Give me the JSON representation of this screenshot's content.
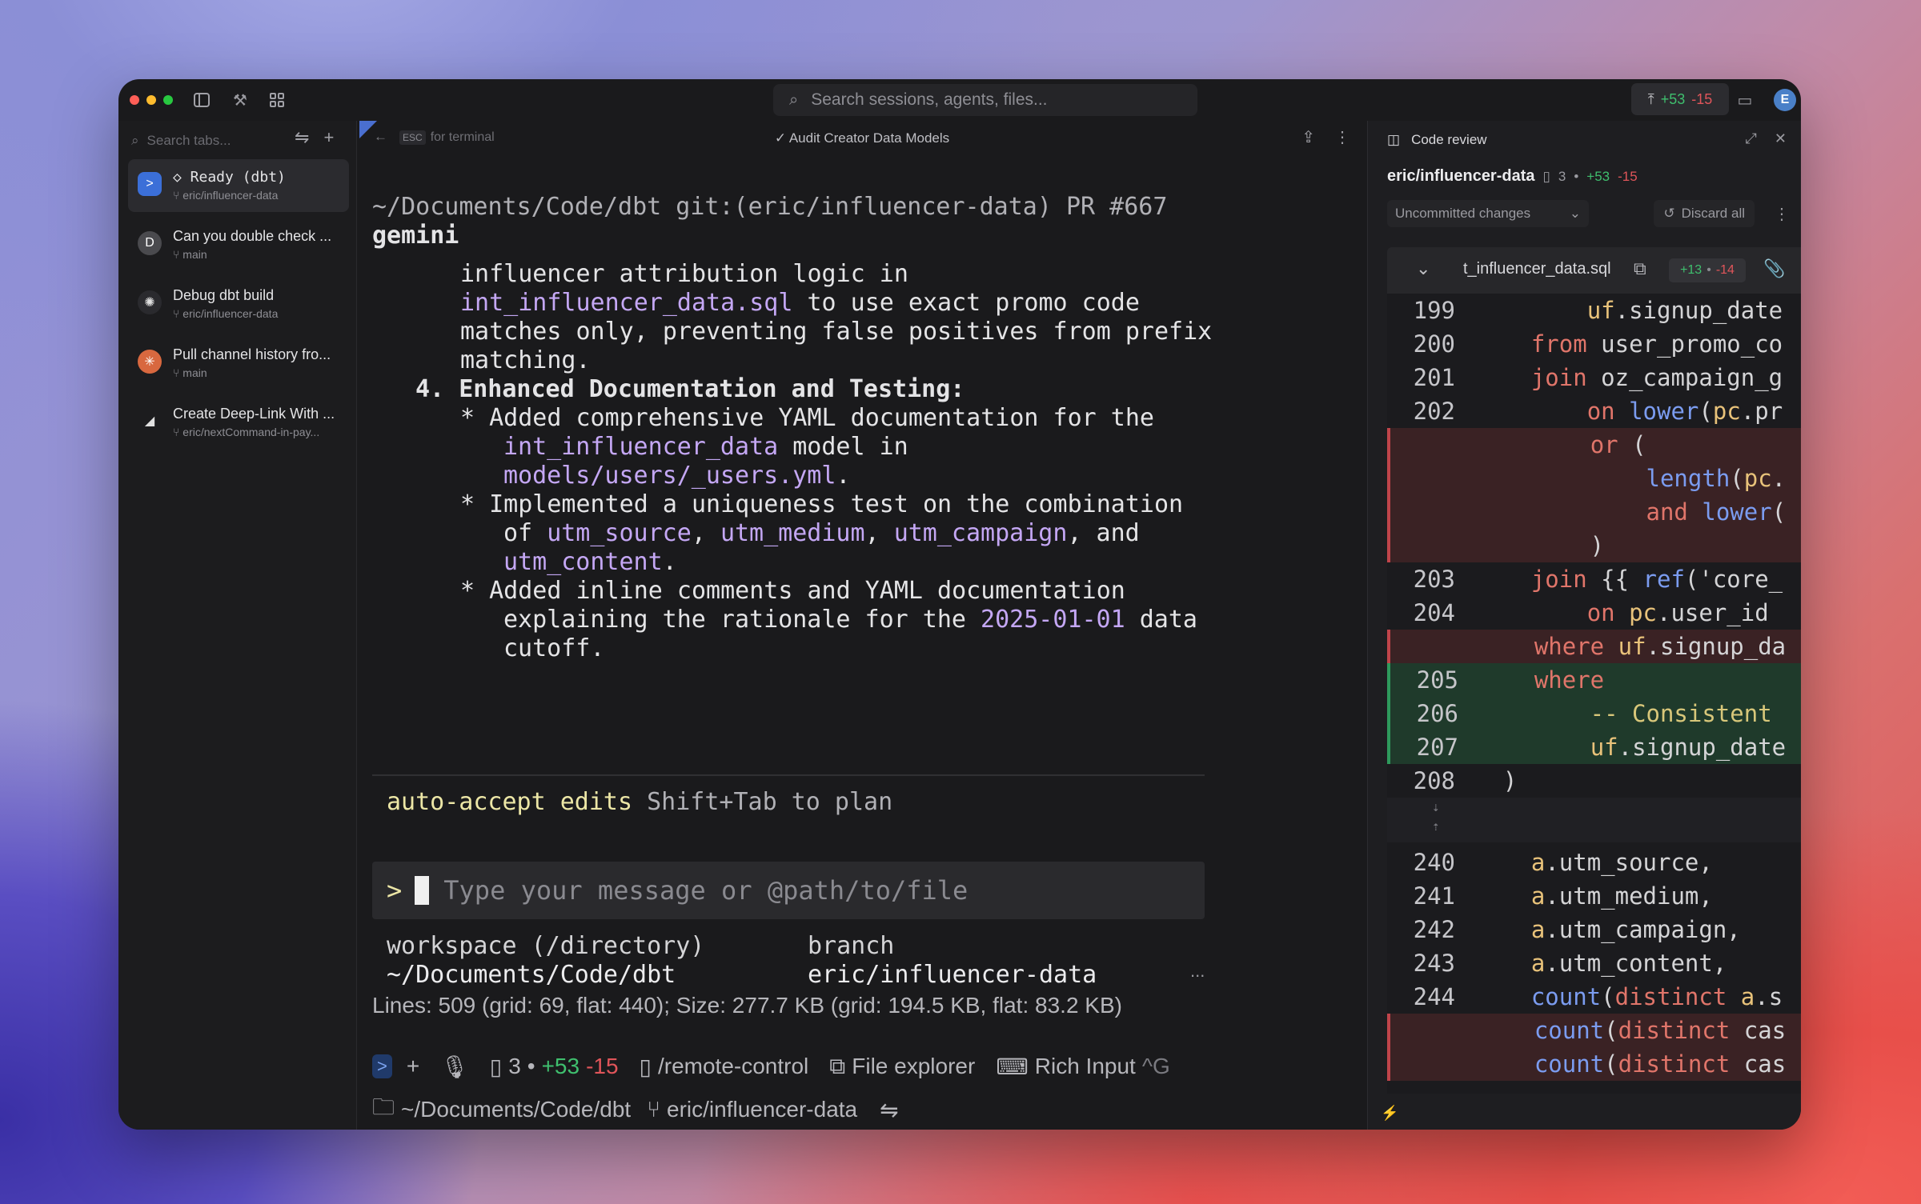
{
  "search": {
    "placeholder": "Search sessions, agents, files..."
  },
  "titlebar": {
    "diff_add": "+53",
    "diff_del": "-15",
    "avatar": "E"
  },
  "sidebar": {
    "search_placeholder": "Search tabs...",
    "tabs": [
      {
        "title": "◇  Ready (dbt)",
        "sub": "eric/influencer-data",
        "active": true
      },
      {
        "title": "Can you double check ...",
        "sub": "main"
      },
      {
        "title": "Debug dbt build",
        "sub": "eric/influencer-data"
      },
      {
        "title": "Pull channel history fro...",
        "sub": "main"
      },
      {
        "title": "Create Deep-Link With ...",
        "sub": "eric/nextCommand-in-pay..."
      }
    ]
  },
  "center": {
    "esc_key": "ESC",
    "esc_label": "for terminal",
    "title": "Audit Creator Data Models",
    "prompt_path": "~/Documents/Code/dbt git:(eric/influencer-data) PR #667",
    "agent": "gemini",
    "lines": {
      "l1": "influencer attribution logic in",
      "l2a": "int_influencer_data.sql",
      "l2b": " to use exact promo code",
      "l3": "matches only, preventing false positives from prefix",
      "l4": "matching.",
      "l5a": "4. ",
      "l5b": "Enhanced Documentation and Testing:",
      "l6": "* Added comprehensive YAML documentation for the",
      "l7a": "int_influencer_data",
      "l7b": " model in",
      "l8a": "models/users/_users.yml",
      "l8b": ".",
      "l9": "* Implemented a uniqueness test on the combination",
      "l10a": "of ",
      "l10b": "utm_source",
      "l10c": ", ",
      "l10d": "utm_medium",
      "l10e": ", ",
      "l10f": "utm_campaign",
      "l10g": ", and",
      "l11a": "utm_content",
      "l11b": ".",
      "l12": "* Added inline comments and YAML documentation",
      "l13a": "explaining the rationale for the ",
      "l13b": "2025-01-01",
      "l13c": " data",
      "l14": "cutoff."
    },
    "mode_label": "auto-accept edits",
    "mode_hint": "Shift+Tab to plan",
    "input_prompt": ">",
    "input_placeholder": "Type your message or @path/to/file",
    "ws_label": "workspace (/directory)",
    "ws_value": "~/Documents/Code/dbt",
    "branch_label": "branch",
    "branch_value": "eric/influencer-data",
    "ellipsis": "...",
    "stats": "Lines: 509 (grid: 69, flat: 440); Size: 277.7 KB (grid: 194.5 KB, flat: 83.2 KB)",
    "bar": {
      "files": "3",
      "dot": "•",
      "add": "+53",
      "del": "-15",
      "remote": "/remote-control",
      "explorer": "File explorer",
      "rich": "Rich Input",
      "shortcut": "^G",
      "path": "~/Documents/Code/dbt",
      "branch": "eric/influencer-data"
    }
  },
  "review": {
    "title": "Code review",
    "branch": "eric/influencer-data",
    "files": "3",
    "dot": "•",
    "add": "+53",
    "del": "-15",
    "scope": "Uncommitted changes",
    "discard": "Discard all",
    "file_name": "t_influencer_data.sql",
    "file_add": "+13",
    "file_del": "-14",
    "lines": [
      {
        "n": "199",
        "t": "        uf.signup_date",
        "k": "ctx"
      },
      {
        "n": "200",
        "t": "    from user_promo_co",
        "k": "ctx"
      },
      {
        "n": "201",
        "t": "    join oz_campaign_g",
        "k": "ctx"
      },
      {
        "n": "202",
        "t": "        on lower(pc.pr",
        "k": "ctx"
      },
      {
        "n": "",
        "t": "        or (",
        "k": "del"
      },
      {
        "n": "",
        "t": "            length(pc.",
        "k": "del"
      },
      {
        "n": "",
        "t": "            and lower(",
        "k": "del"
      },
      {
        "n": "",
        "t": "        )",
        "k": "del"
      },
      {
        "n": "203",
        "t": "    join {{ ref('core_",
        "k": "ctx"
      },
      {
        "n": "204",
        "t": "        on pc.user_id",
        "k": "ctx"
      },
      {
        "n": "",
        "t": "    where uf.signup_da",
        "k": "del"
      },
      {
        "n": "205",
        "t": "    where",
        "k": "add"
      },
      {
        "n": "206",
        "t": "        -- Consistent",
        "k": "add"
      },
      {
        "n": "207",
        "t": "        uf.signup_date",
        "k": "add"
      },
      {
        "n": "208",
        "t": "  )",
        "k": "ctx"
      },
      {
        "n": "240",
        "t": "    a.utm_source,",
        "k": "ctx"
      },
      {
        "n": "241",
        "t": "    a.utm_medium,",
        "k": "ctx"
      },
      {
        "n": "242",
        "t": "    a.utm_campaign,",
        "k": "ctx"
      },
      {
        "n": "243",
        "t": "    a.utm_content,",
        "k": "ctx"
      },
      {
        "n": "244",
        "t": "    count(distinct a.s",
        "k": "ctx"
      },
      {
        "n": "",
        "t": "    count(distinct cas",
        "k": "del"
      },
      {
        "n": "",
        "t": "    count(distinct cas",
        "k": "del"
      }
    ]
  },
  "colors": {
    "accent": "#4a80c8",
    "add": "#3fbf6e",
    "del": "#e0555a",
    "purple": "#c4a7f4"
  }
}
